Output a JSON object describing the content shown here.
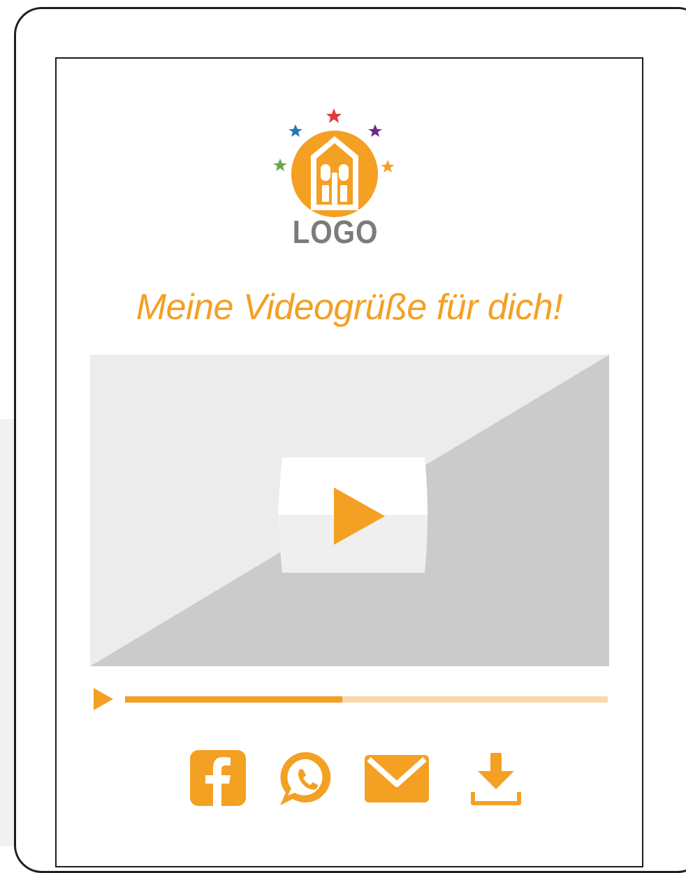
{
  "logo": {
    "text": "LOGO",
    "icon": "logo-house-stars-icon"
  },
  "headline": "Meine Videogrüße für dich!",
  "video": {
    "play_icon": "play-icon",
    "progress": 0.45
  },
  "share": [
    {
      "name": "facebook-icon"
    },
    {
      "name": "whatsapp-icon"
    },
    {
      "name": "mail-icon"
    },
    {
      "name": "download-icon"
    }
  ],
  "colors": {
    "accent": "#f4a023",
    "accent_light": "#f9d8ab",
    "video_light": "#ececec",
    "video_dark": "#cbcbcb",
    "frame": "#1e1e1e",
    "logo_gray": "#7b7b7b"
  }
}
